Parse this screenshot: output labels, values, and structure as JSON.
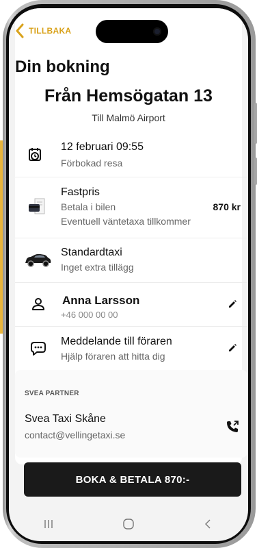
{
  "header": {
    "back_label": "TILLBAKA",
    "page_title": "Din bokning"
  },
  "route": {
    "from": "Från Hemsögatan 13",
    "to": "Till Malmö Airport"
  },
  "rows": {
    "datetime": {
      "title": "12 februari 09:55",
      "subtitle": "Förbokad resa",
      "icon": "calendar-clock-icon"
    },
    "price": {
      "title": "Fastpris",
      "subtitle_1": "Betala i bilen",
      "subtitle_2": "Eventuell väntetaxa tillkommer",
      "amount": "870 kr",
      "icon": "card-receipt-icon"
    },
    "vehicle": {
      "title": "Standardtaxi",
      "subtitle": "Inget extra tillägg",
      "icon": "taxi-car-icon"
    },
    "passenger": {
      "name": "Anna Larsson",
      "phone": "+46 000 00 00",
      "icon": "person-icon"
    },
    "message": {
      "title": "Meddelande till föraren",
      "subtitle": "Hjälp föraren att hitta dig",
      "icon": "chat-bubble-icon"
    }
  },
  "partner": {
    "section_label": "SVEA PARTNER",
    "name": "Svea Taxi Skåne",
    "email": "contact@vellingetaxi.se",
    "icon": "phone-call-icon"
  },
  "cta": {
    "label": "BOKA & BETALA 870:-"
  },
  "colors": {
    "accent": "#d9a21b",
    "side_accent": "#e9b53d",
    "button_bg": "#1a1a1a",
    "screen_bg": "#f3f3f3"
  },
  "system_nav": {
    "icons": [
      "recent-apps-icon",
      "home-icon",
      "back-icon"
    ]
  }
}
